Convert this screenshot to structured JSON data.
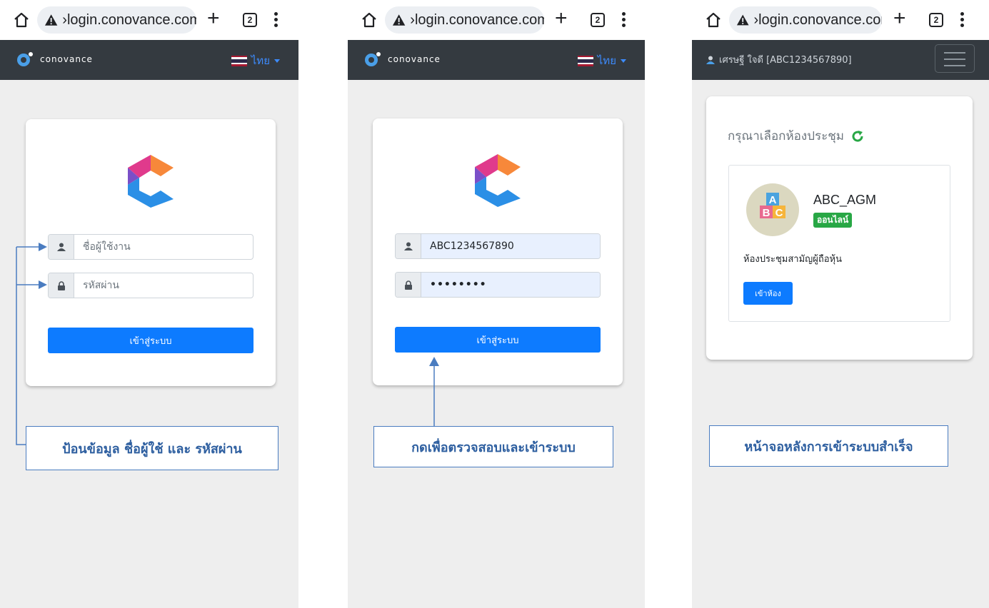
{
  "browser": {
    "url": "›login.conovance.com",
    "tab_count": "2"
  },
  "brand": {
    "name": "conovance"
  },
  "language": {
    "label": "ไทย"
  },
  "login_form": {
    "username_placeholder": "ชื่อผู้ใช้งาน",
    "password_placeholder": "รหัสผ่าน",
    "login_button": "เข้าสู่ระบบ"
  },
  "filled_form": {
    "username_value": "ABC1234567890",
    "password_value": "••••••••"
  },
  "after_login": {
    "user_label": "เศรษฐี ใจดี [ABC1234567890]",
    "room_prompt": "กรุณาเลือกห้องประชุม",
    "room": {
      "name": "ABC_AGM",
      "status": "ออนไลน์",
      "description": "ห้องประชุมสามัญผู้ถือหุ้น",
      "enter_button": "เข้าห้อง"
    }
  },
  "callouts": {
    "step1": "ป้อนข้อมูล ชื่อผู้ใช้ และ รหัสผ่าน",
    "step2": "กดเพื่อตรวจสอบและเข้าระบบ",
    "step3": "หน้าจอหลังการเข้าระบบสำเร็จ"
  },
  "colors": {
    "navbar": "#343a40",
    "primary": "#0d7bff",
    "success": "#28a745",
    "callout": "#4a7cc0"
  }
}
